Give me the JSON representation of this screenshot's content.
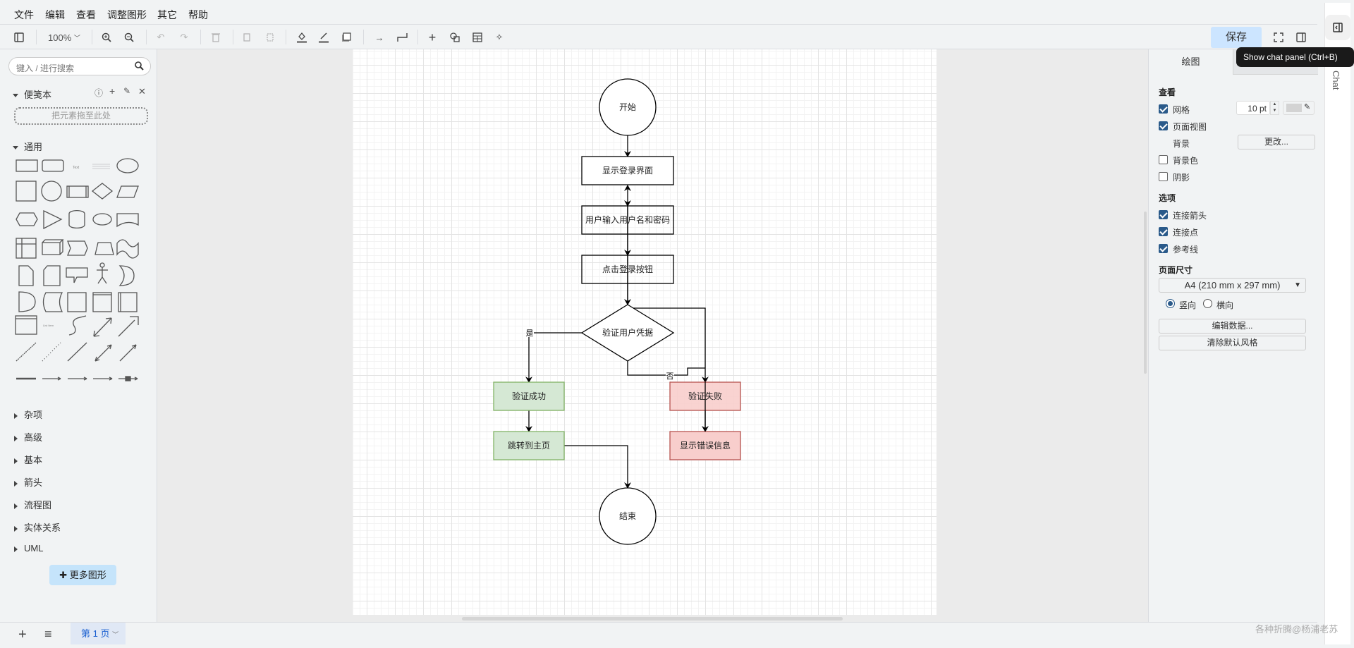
{
  "menubar": {
    "items": [
      "文件",
      "编辑",
      "查看",
      "调整图形",
      "其它",
      "帮助"
    ]
  },
  "toolbar": {
    "zoom": "100%",
    "save": "保存"
  },
  "tooltip": "Show chat panel (Ctrl+B)",
  "chat_tab_label": "Chat",
  "sidebar": {
    "search_placeholder": "键入 / 进行搜索",
    "scratchpad": {
      "title": "便笺本",
      "drop_hint": "把元素拖至此处"
    },
    "general": {
      "title": "通用"
    },
    "categories": [
      "杂项",
      "高级",
      "基本",
      "箭头",
      "流程图",
      "实体关系",
      "UML"
    ],
    "more_shapes": "更多图形"
  },
  "diagram": {
    "nodes": {
      "start": "开始",
      "show_login": "显示登录界面",
      "input": "用户输入用户名和密码",
      "click": "点击登录按钮",
      "verify": "验证用户凭据",
      "success": "验证成功",
      "fail": "验证失败",
      "goto_home": "跳转到主页",
      "show_error": "显示错误信息",
      "end": "结束"
    },
    "edge_labels": {
      "yes": "是",
      "no": "否"
    },
    "colors": {
      "success_fill": "#d5e8d4",
      "success_stroke": "#82b366",
      "fail_fill": "#f8cecc",
      "fail_stroke": "#b85450"
    }
  },
  "rpanel": {
    "tabs": [
      "绘图",
      ""
    ],
    "view": {
      "title": "查看",
      "grid": "网格",
      "grid_checked": true,
      "grid_size": "10 pt",
      "page_view": "页面视图",
      "page_view_checked": true,
      "background": "背景",
      "change": "更改...",
      "bg_color": "背景色",
      "bg_color_checked": false,
      "shadow": "阴影",
      "shadow_checked": false
    },
    "options": {
      "title": "选项",
      "connection_arrows": "连接箭头",
      "connection_points": "连接点",
      "guides": "参考线"
    },
    "page_size": {
      "title": "页面尺寸",
      "selected": "A4 (210 mm x 297 mm)",
      "portrait": "竖向",
      "landscape": "横向",
      "orientation": "portrait"
    },
    "edit_data": "编辑数据...",
    "clear_style": "清除默认风格"
  },
  "bottombar": {
    "page_tab": "第 1 页"
  },
  "watermark": "各种折腾@杨浦老苏"
}
